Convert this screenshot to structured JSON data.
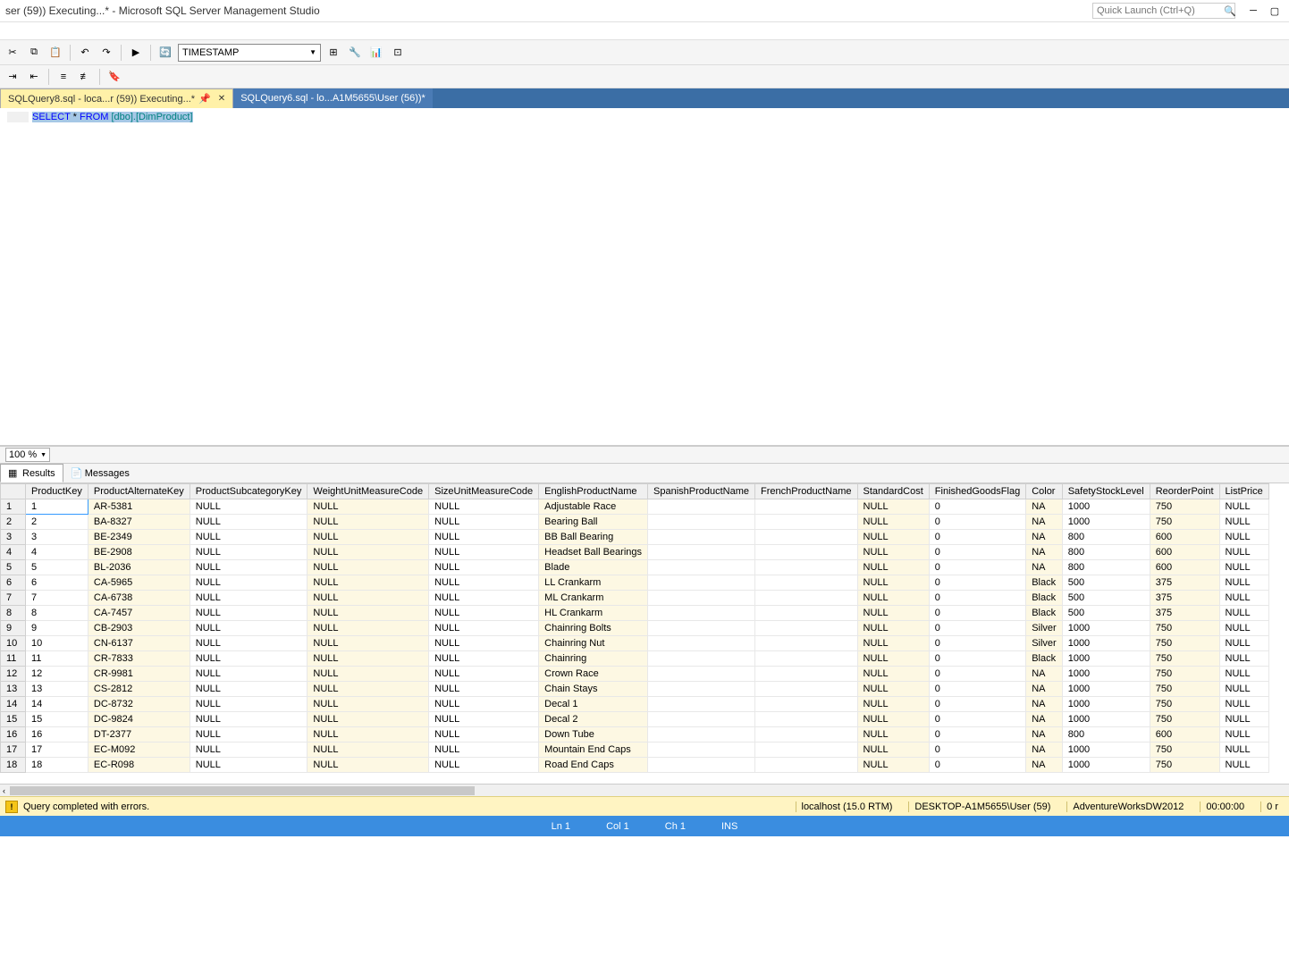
{
  "window": {
    "title": "ser (59)) Executing...* - Microsoft SQL Server Management Studio",
    "quick_launch_placeholder": "Quick Launch (Ctrl+Q)"
  },
  "toolbar": {
    "combo_value": "TIMESTAMP"
  },
  "tabs": {
    "active": "SQLQuery8.sql - loca...r (59)) Executing...*",
    "inactive": "SQLQuery6.sql - lo...A1M5655\\User (56))*"
  },
  "editor": {
    "sql_select": "SELECT",
    "sql_star": "*",
    "sql_from": "FROM",
    "sql_obj": "[dbo].[DimProduct]"
  },
  "zoom": {
    "value": "100 %"
  },
  "results_tabs": {
    "results": "Results",
    "messages": "Messages"
  },
  "columns": [
    "ProductKey",
    "ProductAlternateKey",
    "ProductSubcategoryKey",
    "WeightUnitMeasureCode",
    "SizeUnitMeasureCode",
    "EnglishProductName",
    "SpanishProductName",
    "FrenchProductName",
    "StandardCost",
    "FinishedGoodsFlag",
    "Color",
    "SafetyStockLevel",
    "ReorderPoint",
    "ListPrice"
  ],
  "rows": [
    {
      "n": "1",
      "ProductKey": "1",
      "AltKey": "AR-5381",
      "SubCat": "NULL",
      "WUM": "NULL",
      "SUM": "NULL",
      "Name": "Adjustable Race",
      "Span": "",
      "Fren": "",
      "Cost": "NULL",
      "Flag": "0",
      "Color": "NA",
      "Safety": "1000",
      "Reorder": "750",
      "List": "NULL"
    },
    {
      "n": "2",
      "ProductKey": "2",
      "AltKey": "BA-8327",
      "SubCat": "NULL",
      "WUM": "NULL",
      "SUM": "NULL",
      "Name": "Bearing Ball",
      "Span": "",
      "Fren": "",
      "Cost": "NULL",
      "Flag": "0",
      "Color": "NA",
      "Safety": "1000",
      "Reorder": "750",
      "List": "NULL"
    },
    {
      "n": "3",
      "ProductKey": "3",
      "AltKey": "BE-2349",
      "SubCat": "NULL",
      "WUM": "NULL",
      "SUM": "NULL",
      "Name": "BB Ball Bearing",
      "Span": "",
      "Fren": "",
      "Cost": "NULL",
      "Flag": "0",
      "Color": "NA",
      "Safety": "800",
      "Reorder": "600",
      "List": "NULL"
    },
    {
      "n": "4",
      "ProductKey": "4",
      "AltKey": "BE-2908",
      "SubCat": "NULL",
      "WUM": "NULL",
      "SUM": "NULL",
      "Name": "Headset Ball Bearings",
      "Span": "",
      "Fren": "",
      "Cost": "NULL",
      "Flag": "0",
      "Color": "NA",
      "Safety": "800",
      "Reorder": "600",
      "List": "NULL"
    },
    {
      "n": "5",
      "ProductKey": "5",
      "AltKey": "BL-2036",
      "SubCat": "NULL",
      "WUM": "NULL",
      "SUM": "NULL",
      "Name": "Blade",
      "Span": "",
      "Fren": "",
      "Cost": "NULL",
      "Flag": "0",
      "Color": "NA",
      "Safety": "800",
      "Reorder": "600",
      "List": "NULL"
    },
    {
      "n": "6",
      "ProductKey": "6",
      "AltKey": "CA-5965",
      "SubCat": "NULL",
      "WUM": "NULL",
      "SUM": "NULL",
      "Name": "LL Crankarm",
      "Span": "",
      "Fren": "",
      "Cost": "NULL",
      "Flag": "0",
      "Color": "Black",
      "Safety": "500",
      "Reorder": "375",
      "List": "NULL"
    },
    {
      "n": "7",
      "ProductKey": "7",
      "AltKey": "CA-6738",
      "SubCat": "NULL",
      "WUM": "NULL",
      "SUM": "NULL",
      "Name": "ML Crankarm",
      "Span": "",
      "Fren": "",
      "Cost": "NULL",
      "Flag": "0",
      "Color": "Black",
      "Safety": "500",
      "Reorder": "375",
      "List": "NULL"
    },
    {
      "n": "8",
      "ProductKey": "8",
      "AltKey": "CA-7457",
      "SubCat": "NULL",
      "WUM": "NULL",
      "SUM": "NULL",
      "Name": "HL Crankarm",
      "Span": "",
      "Fren": "",
      "Cost": "NULL",
      "Flag": "0",
      "Color": "Black",
      "Safety": "500",
      "Reorder": "375",
      "List": "NULL"
    },
    {
      "n": "9",
      "ProductKey": "9",
      "AltKey": "CB-2903",
      "SubCat": "NULL",
      "WUM": "NULL",
      "SUM": "NULL",
      "Name": "Chainring Bolts",
      "Span": "",
      "Fren": "",
      "Cost": "NULL",
      "Flag": "0",
      "Color": "Silver",
      "Safety": "1000",
      "Reorder": "750",
      "List": "NULL"
    },
    {
      "n": "10",
      "ProductKey": "10",
      "AltKey": "CN-6137",
      "SubCat": "NULL",
      "WUM": "NULL",
      "SUM": "NULL",
      "Name": "Chainring Nut",
      "Span": "",
      "Fren": "",
      "Cost": "NULL",
      "Flag": "0",
      "Color": "Silver",
      "Safety": "1000",
      "Reorder": "750",
      "List": "NULL"
    },
    {
      "n": "11",
      "ProductKey": "11",
      "AltKey": "CR-7833",
      "SubCat": "NULL",
      "WUM": "NULL",
      "SUM": "NULL",
      "Name": "Chainring",
      "Span": "",
      "Fren": "",
      "Cost": "NULL",
      "Flag": "0",
      "Color": "Black",
      "Safety": "1000",
      "Reorder": "750",
      "List": "NULL"
    },
    {
      "n": "12",
      "ProductKey": "12",
      "AltKey": "CR-9981",
      "SubCat": "NULL",
      "WUM": "NULL",
      "SUM": "NULL",
      "Name": "Crown Race",
      "Span": "",
      "Fren": "",
      "Cost": "NULL",
      "Flag": "0",
      "Color": "NA",
      "Safety": "1000",
      "Reorder": "750",
      "List": "NULL"
    },
    {
      "n": "13",
      "ProductKey": "13",
      "AltKey": "CS-2812",
      "SubCat": "NULL",
      "WUM": "NULL",
      "SUM": "NULL",
      "Name": "Chain Stays",
      "Span": "",
      "Fren": "",
      "Cost": "NULL",
      "Flag": "0",
      "Color": "NA",
      "Safety": "1000",
      "Reorder": "750",
      "List": "NULL"
    },
    {
      "n": "14",
      "ProductKey": "14",
      "AltKey": "DC-8732",
      "SubCat": "NULL",
      "WUM": "NULL",
      "SUM": "NULL",
      "Name": "Decal 1",
      "Span": "",
      "Fren": "",
      "Cost": "NULL",
      "Flag": "0",
      "Color": "NA",
      "Safety": "1000",
      "Reorder": "750",
      "List": "NULL"
    },
    {
      "n": "15",
      "ProductKey": "15",
      "AltKey": "DC-9824",
      "SubCat": "NULL",
      "WUM": "NULL",
      "SUM": "NULL",
      "Name": "Decal 2",
      "Span": "",
      "Fren": "",
      "Cost": "NULL",
      "Flag": "0",
      "Color": "NA",
      "Safety": "1000",
      "Reorder": "750",
      "List": "NULL"
    },
    {
      "n": "16",
      "ProductKey": "16",
      "AltKey": "DT-2377",
      "SubCat": "NULL",
      "WUM": "NULL",
      "SUM": "NULL",
      "Name": "Down Tube",
      "Span": "",
      "Fren": "",
      "Cost": "NULL",
      "Flag": "0",
      "Color": "NA",
      "Safety": "800",
      "Reorder": "600",
      "List": "NULL"
    },
    {
      "n": "17",
      "ProductKey": "17",
      "AltKey": "EC-M092",
      "SubCat": "NULL",
      "WUM": "NULL",
      "SUM": "NULL",
      "Name": "Mountain End Caps",
      "Span": "",
      "Fren": "",
      "Cost": "NULL",
      "Flag": "0",
      "Color": "NA",
      "Safety": "1000",
      "Reorder": "750",
      "List": "NULL"
    },
    {
      "n": "18",
      "ProductKey": "18",
      "AltKey": "EC-R098",
      "SubCat": "NULL",
      "WUM": "NULL",
      "SUM": "NULL",
      "Name": "Road End Caps",
      "Span": "",
      "Fren": "",
      "Cost": "NULL",
      "Flag": "0",
      "Color": "NA",
      "Safety": "1000",
      "Reorder": "750",
      "List": "NULL"
    }
  ],
  "status": {
    "message": "Query completed with errors.",
    "server": "localhost (15.0 RTM)",
    "user": "DESKTOP-A1M5655\\User (59)",
    "db": "AdventureWorksDW2012",
    "time": "00:00:00",
    "rows_label": "0 r"
  },
  "footer": {
    "ln": "Ln 1",
    "col": "Col 1",
    "ch": "Ch 1",
    "ins": "INS"
  }
}
